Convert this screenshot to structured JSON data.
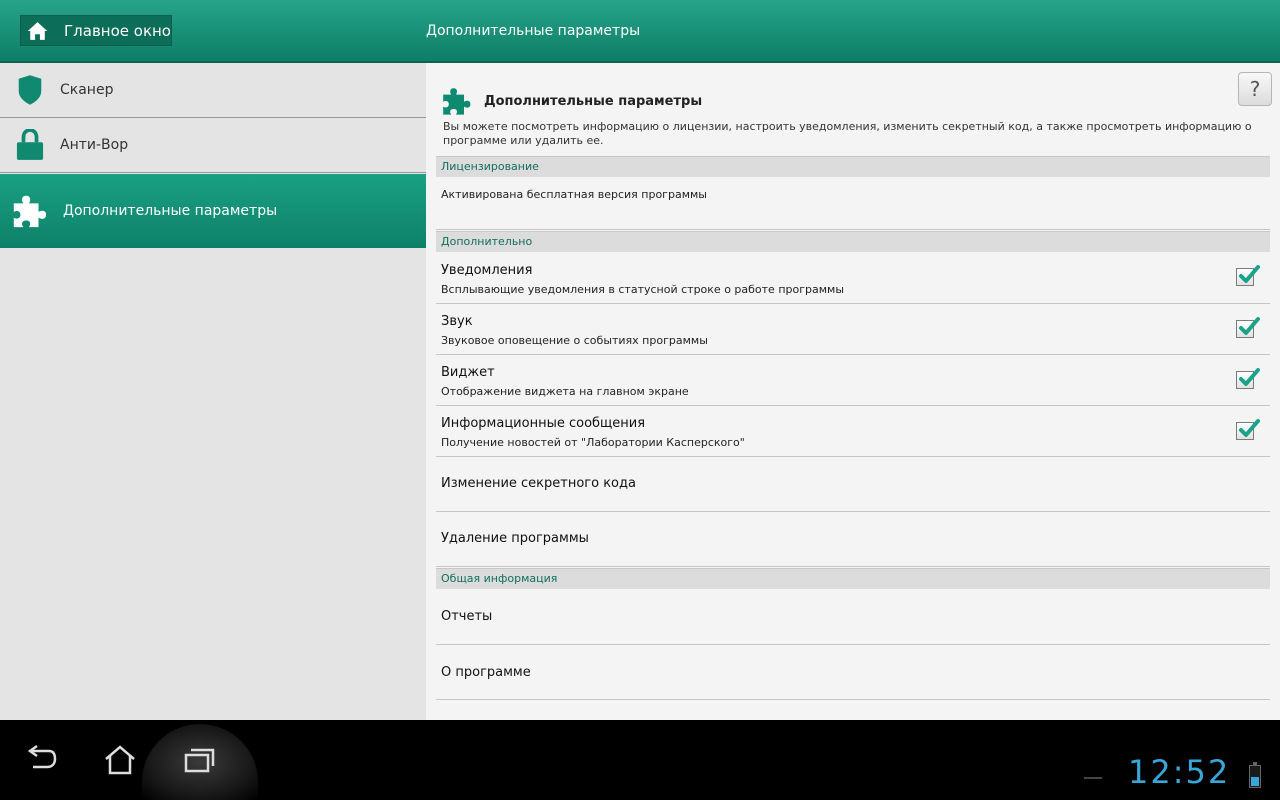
{
  "topbar": {
    "home_label": "Главное окно",
    "title": "Дополнительные параметры",
    "bg_color": "#0e7e66"
  },
  "sidebar": {
    "items": [
      {
        "label": "Сканер",
        "icon": "shield-icon"
      },
      {
        "label": "Анти-Вор",
        "icon": "lock-icon"
      },
      {
        "label": "Дополнительные параметры",
        "icon": "puzzle-icon",
        "active": true
      }
    ]
  },
  "main": {
    "help_label": "?",
    "title": "Дополнительные параметры",
    "description": "Вы можете посмотреть информацию о лицензии, настроить уведомления, изменить секретный код, а также просмотреть информацию о программе или удалить ее.",
    "sections": {
      "licensing": {
        "header": "Лицензирование",
        "text": "Активирована бесплатная версия программы"
      },
      "additional": {
        "header": "Дополнительно",
        "rows": [
          {
            "title": "Уведомления",
            "subtitle": "Всплывающие уведомления в статусной строке о работе программы",
            "checked": true
          },
          {
            "title": "Звук",
            "subtitle": "Звуковое оповещение о событиях программы",
            "checked": true
          },
          {
            "title": "Виджет",
            "subtitle": "Отображение виджета на главном экране",
            "checked": true
          },
          {
            "title": "Информационные сообщения",
            "subtitle": "Получение новостей от \"Лаборатории Касперского\"",
            "checked": true
          }
        ],
        "links": [
          "Изменение секретного кода",
          "Удаление программы"
        ]
      },
      "general": {
        "header": "Общая информация",
        "links": [
          "Отчеты",
          "О программе"
        ]
      }
    },
    "accent_color": "#126e5c",
    "check_color": "#1aa38a"
  },
  "navbar": {
    "clock": "12:52",
    "clock_color": "#3aa6d8"
  }
}
